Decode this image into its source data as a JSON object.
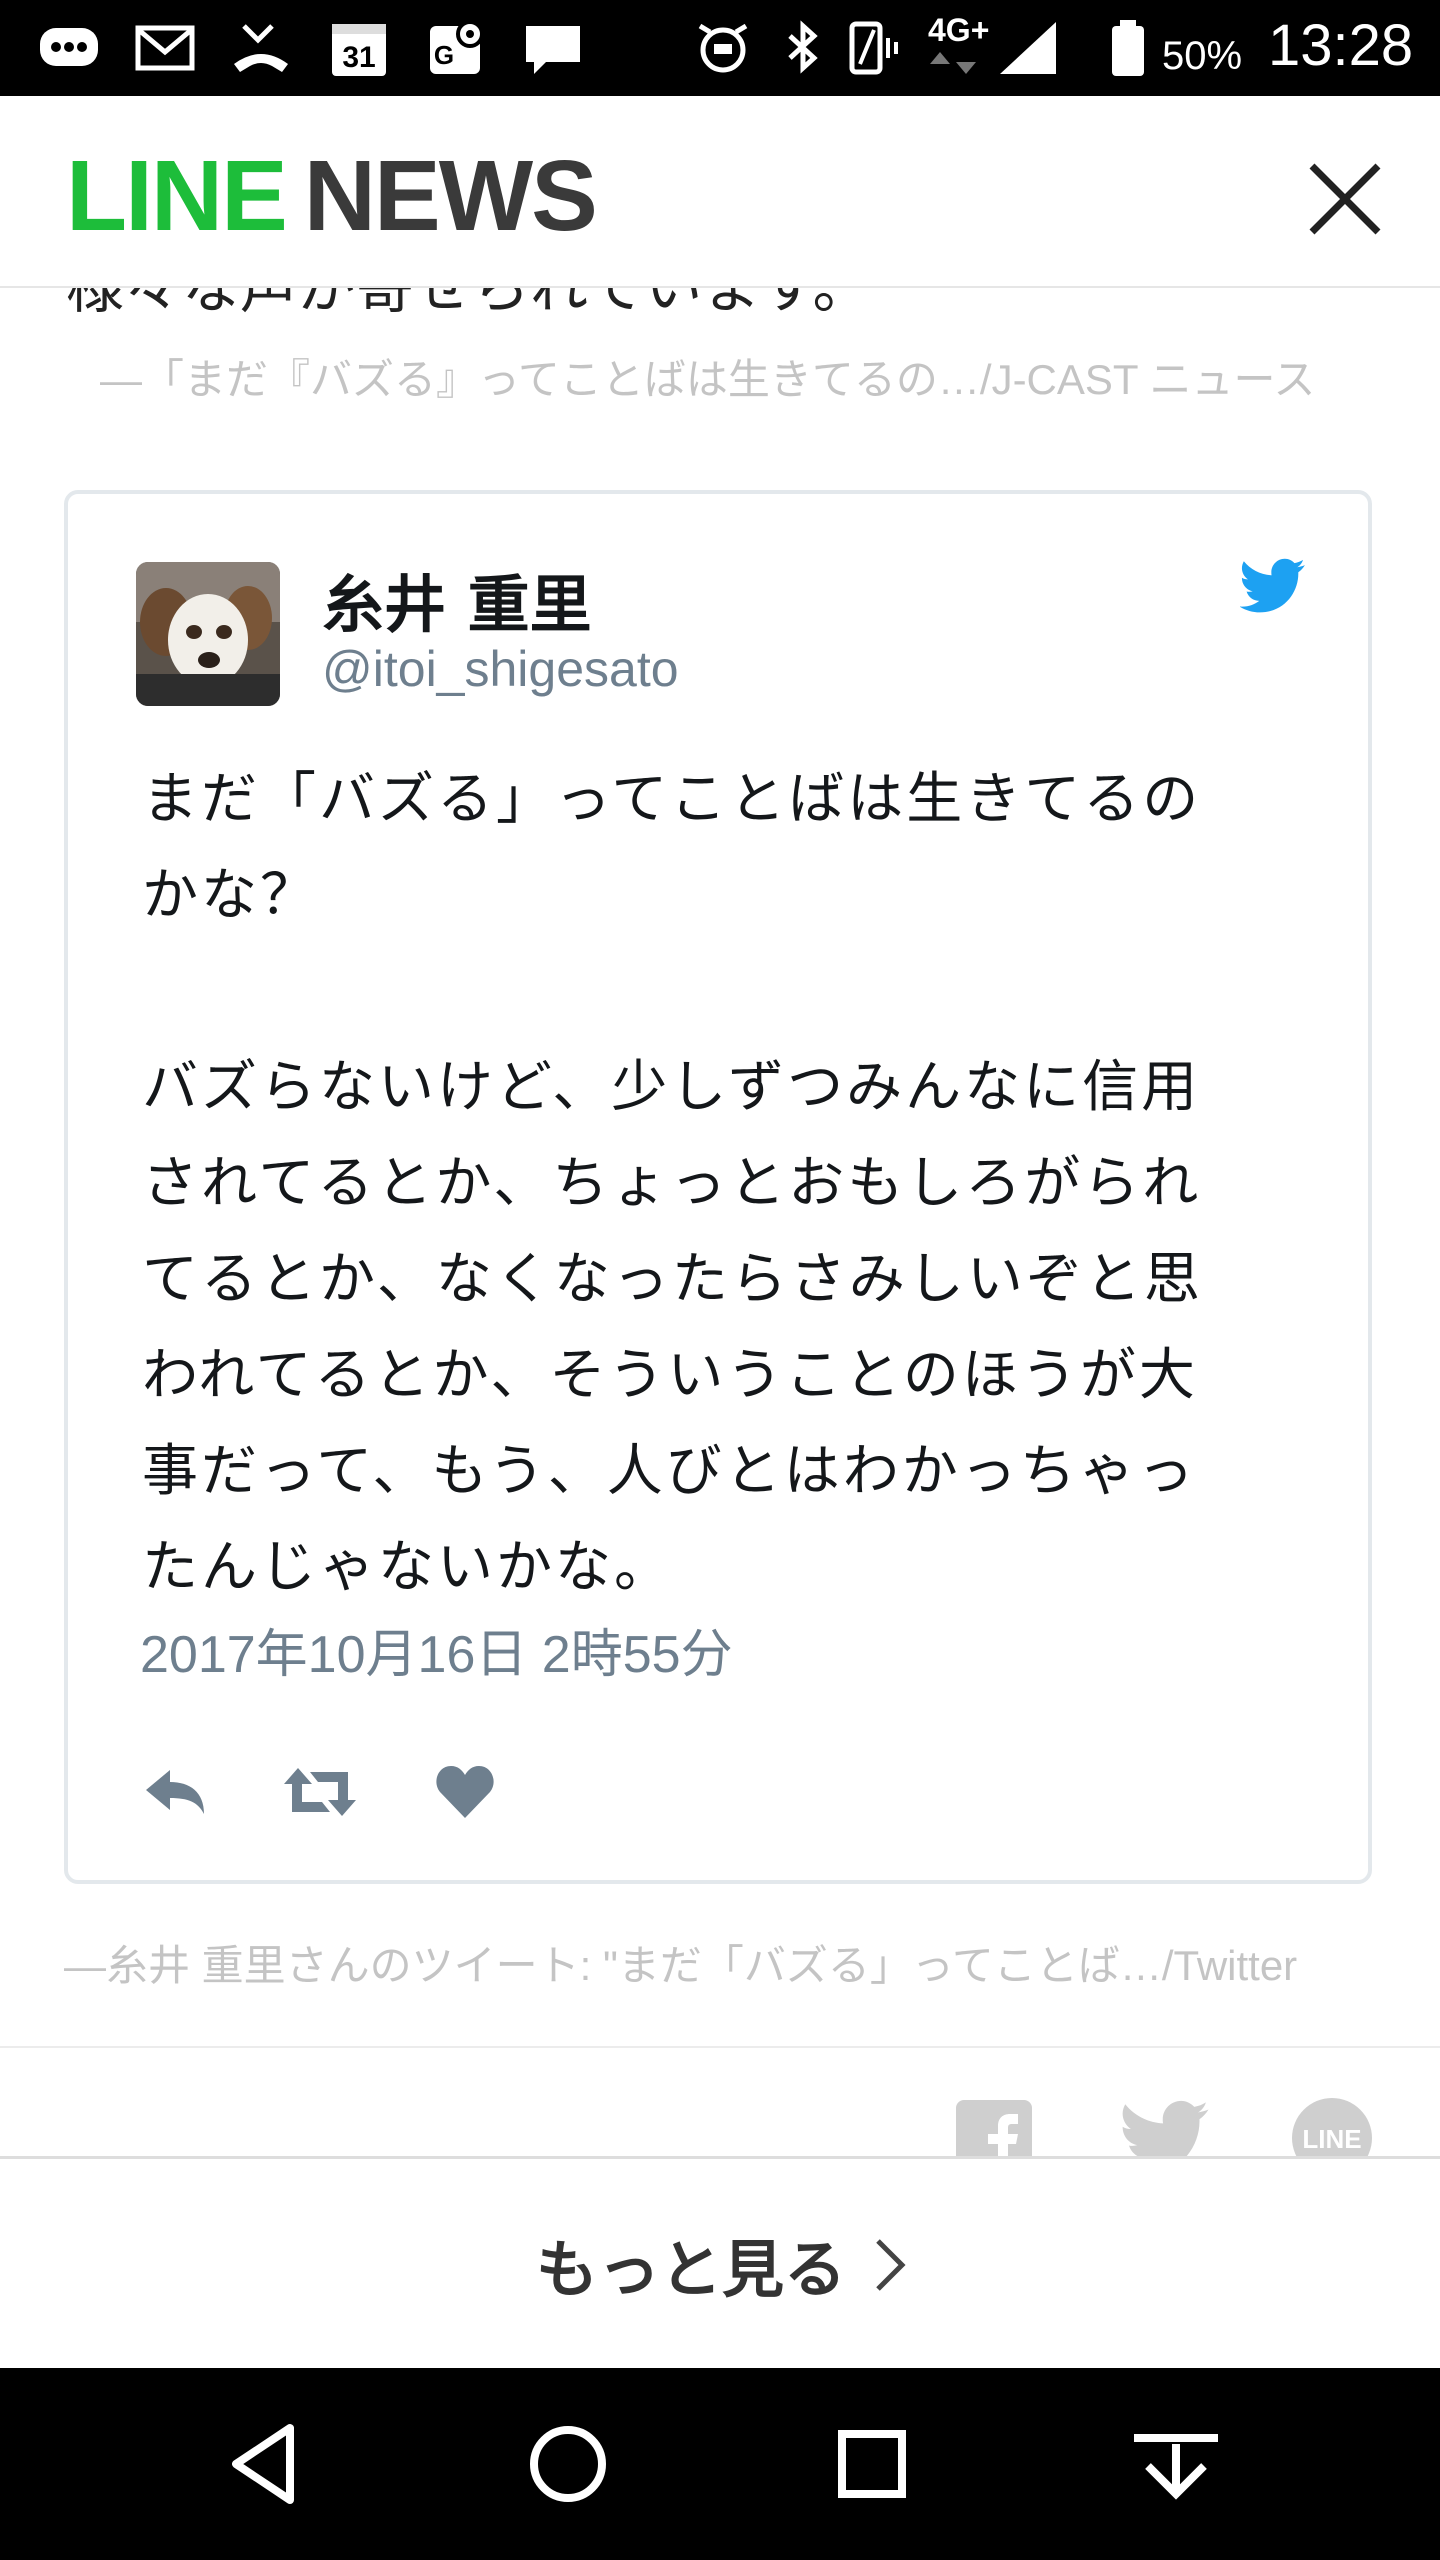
{
  "status_bar": {
    "time": "13:28",
    "battery_percent": "50%",
    "network": "4G+",
    "left_icons": [
      "message-bubble-icon",
      "gmail-icon",
      "missed-call-icon",
      "calendar-icon",
      "maps-icon",
      "chat-icon"
    ],
    "calendar_day": "31",
    "right_icons": [
      "alarm-icon",
      "bluetooth-icon",
      "vibrate-icon",
      "signal-icon",
      "battery-icon"
    ]
  },
  "header": {
    "logo_line": "LINE",
    "logo_news": "NEWS",
    "close_icon": "close-icon",
    "brand_color": "#1dbd3a"
  },
  "article": {
    "cutoff_text": "様々な声が寄せられています。",
    "quote_source": "—「まだ『バズる』ってことばは生きてるの…/J-CAST ニュース"
  },
  "tweet": {
    "author_name": "糸井 重里",
    "author_handle": "@itoi_shigesato",
    "text": "まだ「バズる」ってことばは生きてるの\nかな？\n\nバズらないけど、少しずつみんなに信用\nされてるとか、ちょっとおもしろがられ\nてるとか、なくなったらさみしいぞと思\nわれてるとか、そういうことのほうが大\n事だって、もう、人びとはわかっちゃっ\nたんじゃないかな。",
    "date": "2017年10月16日 2時55分",
    "actions": [
      "reply-icon",
      "retweet-icon",
      "like-icon"
    ],
    "twitter_color": "#1da1f2"
  },
  "embed_source": "—糸井 重里さんのツイート: \"まだ「バズる」ってことば…/Twitter",
  "share": {
    "icons": [
      "facebook-icon",
      "twitter-icon",
      "line-icon"
    ],
    "line_label": "LINE"
  },
  "more": {
    "label": "もっと見る"
  },
  "nav": {
    "buttons": [
      "back-icon",
      "home-icon",
      "recents-icon",
      "download-icon"
    ]
  }
}
